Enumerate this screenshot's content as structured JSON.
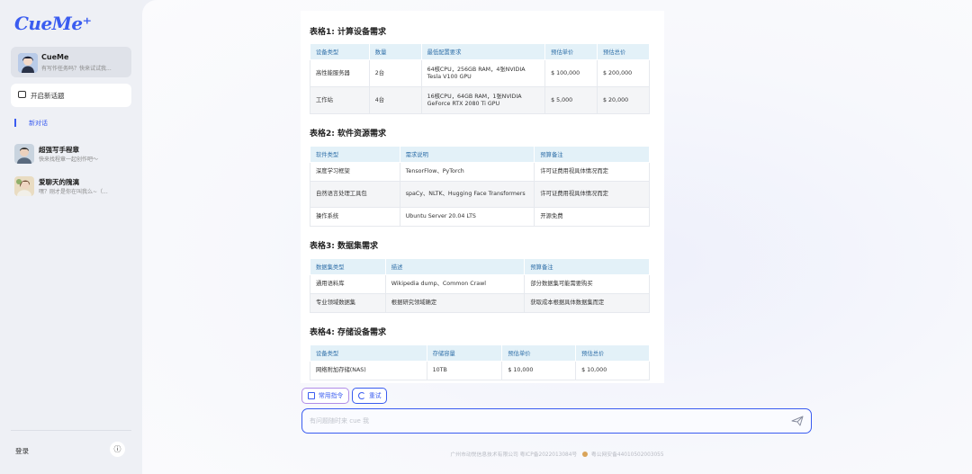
{
  "app": {
    "logo": "CueMe⁺"
  },
  "sidebar": {
    "agent": {
      "name": "CueMe",
      "subtitle": "有写作任务吗？快来试试我..."
    },
    "new_topic": "开启新话题",
    "active_chat": "新对话",
    "chats": [
      {
        "title": "超强写手程章",
        "subtitle": "快来找程章一起创作吧～"
      },
      {
        "title": "爱聊天的隗漓",
        "subtitle": "嘿？刚才是你在叫我么~（..."
      }
    ],
    "login": "登录",
    "info_icon": "ⓘ"
  },
  "tables": [
    {
      "title": "表格1: 计算设备需求",
      "headers": [
        "设备类型",
        "数量",
        "最低配置要求",
        "预估单价",
        "预估总价"
      ],
      "rows": [
        [
          "高性能服务器",
          "2台",
          "64核CPU，256GB RAM，4张NVIDIA Tesla V100 GPU",
          "$ 100,000",
          "$ 200,000"
        ],
        [
          "工作站",
          "4台",
          "16核CPU，64GB RAM，1张NVIDIA GeForce RTX 2080 Ti GPU",
          "$ 5,000",
          "$ 20,000"
        ]
      ]
    },
    {
      "title": "表格2: 软件资源需求",
      "headers": [
        "软件类型",
        "需求说明",
        "预算备注"
      ],
      "rows": [
        [
          "深度学习框架",
          "TensorFlow、PyTorch",
          "许可证费用视具体情况而定"
        ],
        [
          "自然语言处理工具包",
          "spaCy、NLTK、Hugging Face Transformers",
          "许可证费用视具体情况而定"
        ],
        [
          "操作系统",
          "Ubuntu Server 20.04 LTS",
          "开源免费"
        ]
      ]
    },
    {
      "title": "表格3: 数据集需求",
      "headers": [
        "数据集类型",
        "描述",
        "预算备注"
      ],
      "rows": [
        [
          "通用语料库",
          "Wikipedia dump、Common Crawl",
          "部分数据集可能需要购买"
        ],
        [
          "专业领域数据集",
          "根据研究领域确定",
          "获取成本根据具体数据集而定"
        ]
      ]
    },
    {
      "title": "表格4: 存储设备需求",
      "headers": [
        "设备类型",
        "存储容量",
        "预估单价",
        "预估总价"
      ],
      "rows": [
        [
          "网络附加存储(NAS)",
          "10TB",
          "$ 10,000",
          "$ 10,000"
        ]
      ]
    }
  ],
  "controls": {
    "common_commands": "常用指令",
    "retry": "重试",
    "input_placeholder": "有问题随时来 cue 我",
    "send_icon": "paper-plane"
  },
  "footer": {
    "company": "广州市动悦信息技术有限公司 粤ICP备2022013084号",
    "police": "粤公网安备44010502003055"
  },
  "colors": {
    "accent": "#3a5cf0",
    "table_header_bg": "#e3f1f8",
    "table_header_text": "#2f6fa8"
  }
}
